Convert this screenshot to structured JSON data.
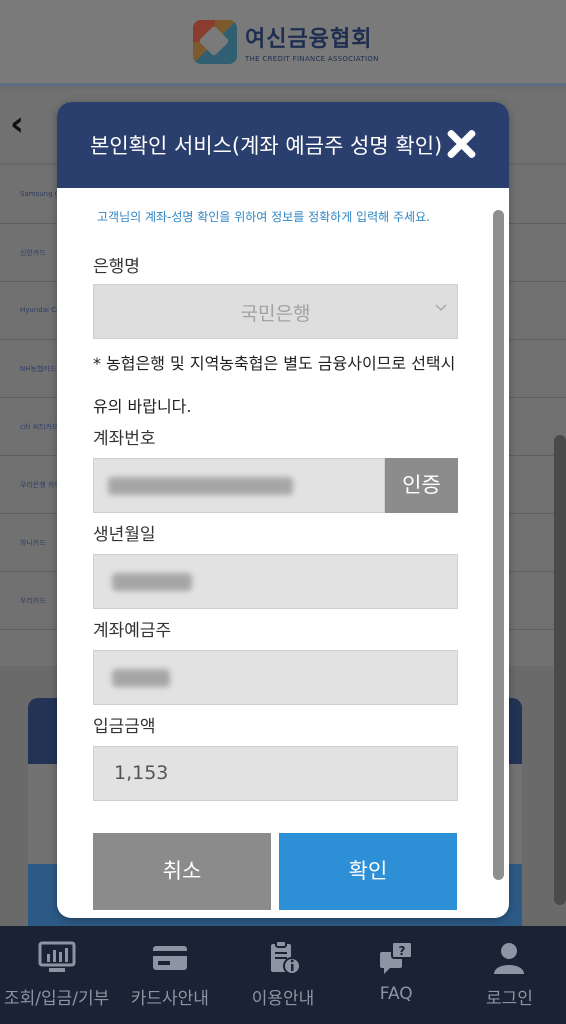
{
  "site": {
    "logo_name": "여신금융협회",
    "logo_sub": "THE CREDIT FINANCE ASSOCIATION"
  },
  "background_list": [
    "Samsung Card",
    "신한카드",
    "Hyundai Card",
    "NH농협카드",
    "citi 씨티카드",
    "우리은행 카드",
    "하나카드",
    "우리카드"
  ],
  "modal": {
    "title": "본인확인 서비스(계좌 예금주 성명 확인)",
    "notice": "고객님의 계좌-성명 확인을 위하여 정보를 정확하게 입력해 주세요.",
    "bank_label": "은행명",
    "bank_selected": "국민은행",
    "bank_note": "* 농협은행 및 지역농축협은 별도 금융사이므로 선택시 유의 바랍니다.",
    "account_label": "계좌번호",
    "verify_button": "인증",
    "birth_label": "생년월일",
    "holder_label": "계좌예금주",
    "amount_label": "입금금액",
    "amount_value": "1,153",
    "cancel_button": "취소",
    "confirm_button": "확인"
  },
  "tabbar": {
    "items": [
      {
        "label": "조회/입금/기부",
        "icon": "monitor-chart-icon"
      },
      {
        "label": "카드사안내",
        "icon": "credit-card-icon"
      },
      {
        "label": "이용안내",
        "icon": "clipboard-info-icon"
      },
      {
        "label": "FAQ",
        "icon": "question-chat-icon"
      },
      {
        "label": "로그인",
        "icon": "user-icon"
      }
    ]
  },
  "colors": {
    "modal_header": "#2b3f6e",
    "confirm": "#2d8fd6",
    "cancel": "#8b8b8b",
    "notice": "#2f86c4",
    "tabbar": "#1a2233"
  }
}
